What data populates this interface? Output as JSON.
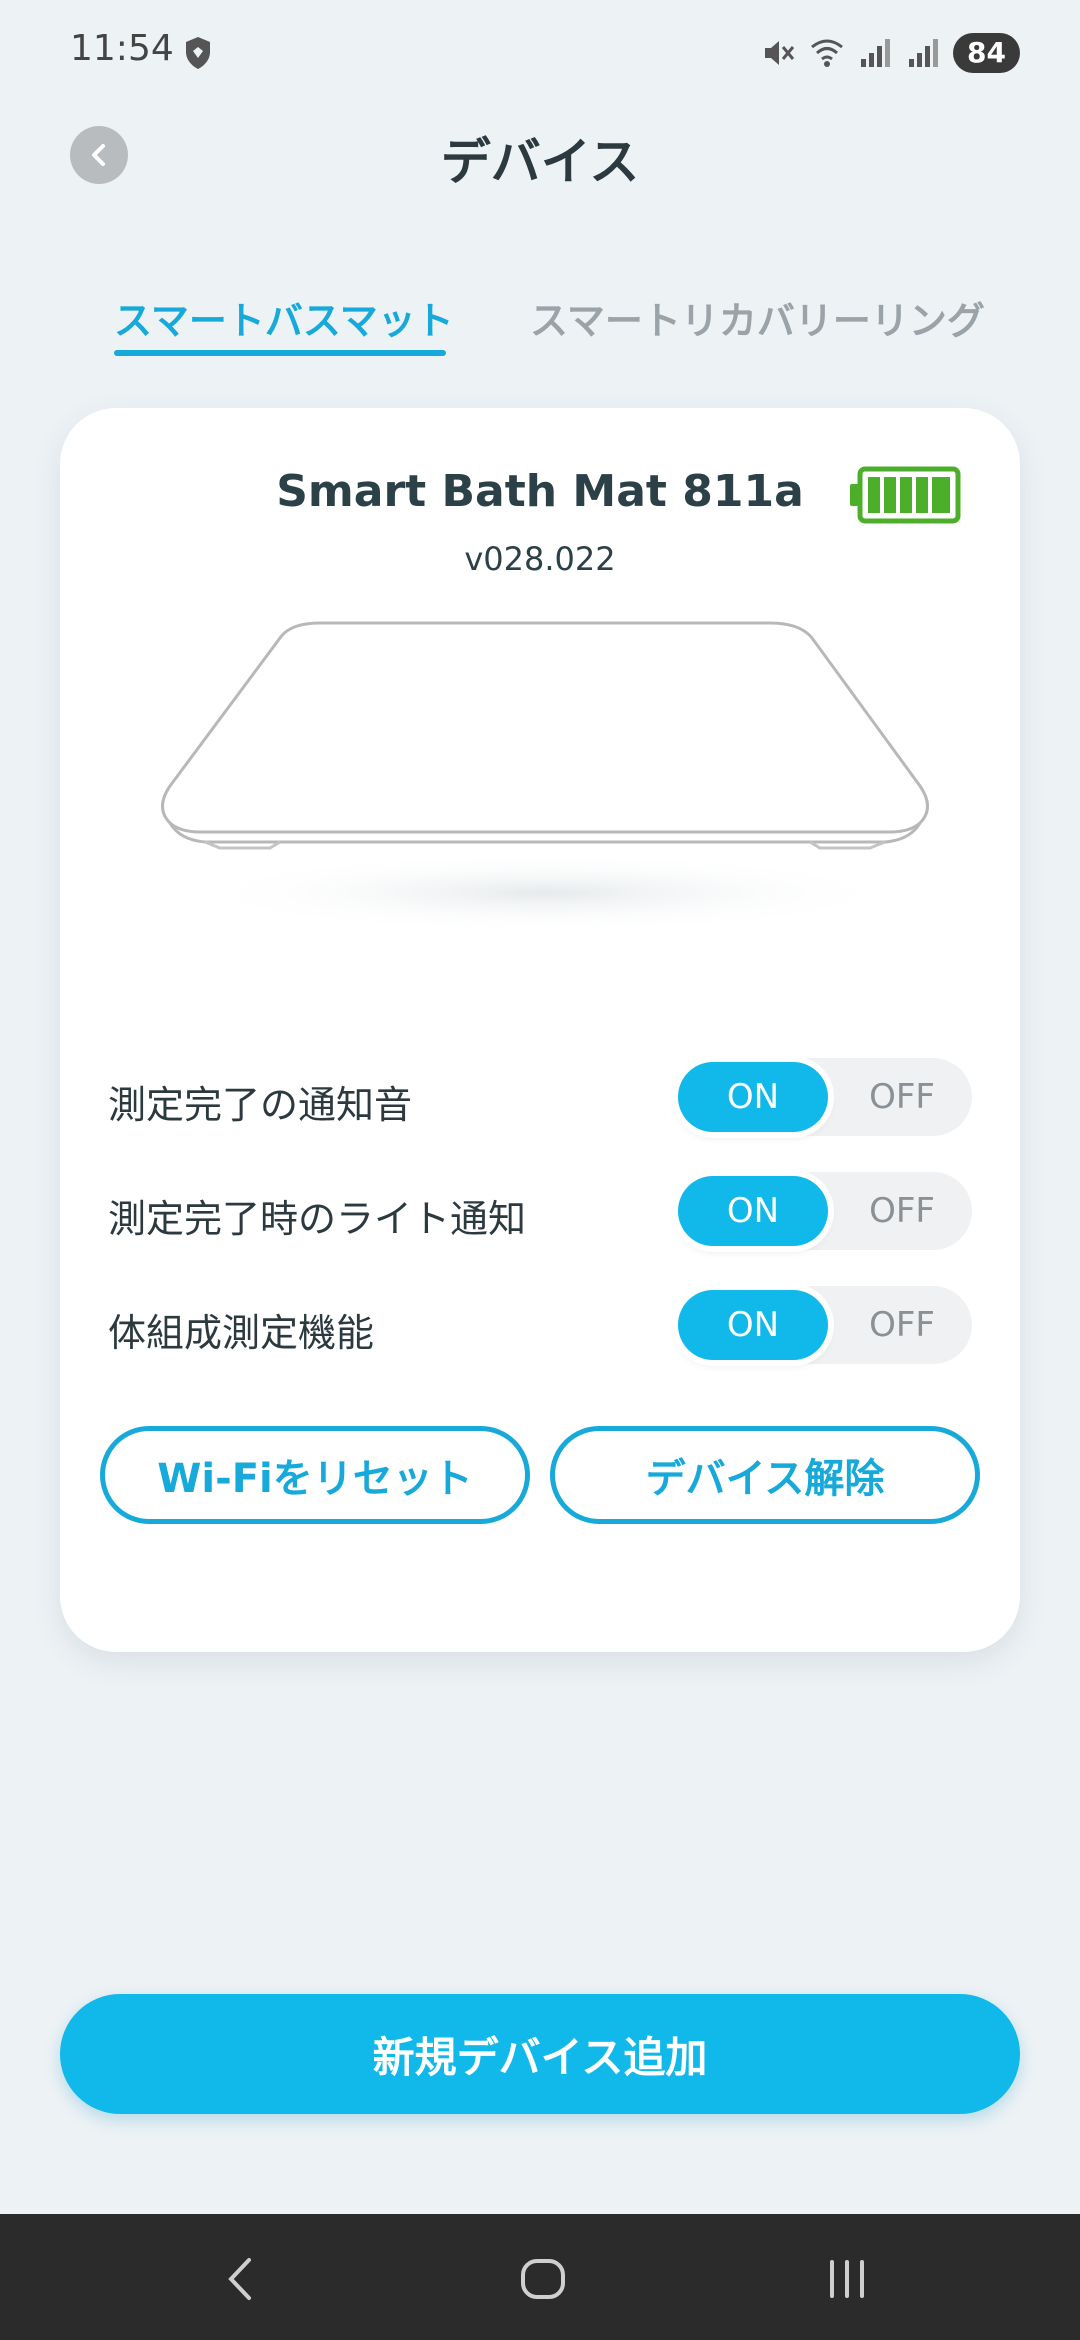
{
  "status_bar": {
    "time": "11:54",
    "battery_level": "84",
    "icons": [
      "shield-icon",
      "mute-icon",
      "wifi-icon",
      "signal-icon",
      "signal-icon"
    ]
  },
  "header": {
    "title": "デバイス"
  },
  "tabs": [
    {
      "label": "スマートバスマット",
      "active": true
    },
    {
      "label": "スマートリカバリーリング",
      "active": false
    }
  ],
  "device": {
    "name": "Smart Bath Mat 811a",
    "firmware": "v028.022",
    "battery_color": "#4caf2a"
  },
  "settings": [
    {
      "label": "測定完了の通知音",
      "on_label": "ON",
      "off_label": "OFF",
      "state": "ON"
    },
    {
      "label": "測定完了時のライト通知",
      "on_label": "ON",
      "off_label": "OFF",
      "state": "ON"
    },
    {
      "label": "体組成測定機能",
      "on_label": "ON",
      "off_label": "OFF",
      "state": "ON"
    }
  ],
  "actions": {
    "reset_wifi": "Wi-Fiをリセット",
    "release_device": "デバイス解除"
  },
  "add_device": "新規デバイス追加",
  "colors": {
    "accent": "#10b9ea",
    "background": "#edf2f5"
  }
}
